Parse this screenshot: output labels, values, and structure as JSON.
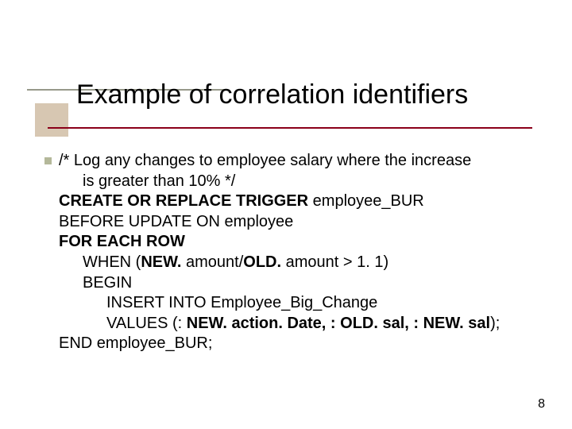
{
  "title": "Example of correlation identifiers",
  "page_number": "8",
  "body": {
    "comment_l1": "/* Log any changes to employee salary where the increase",
    "comment_l2": "is greater than 10% */",
    "create_b": "CREATE OR REPLACE TRIGGER ",
    "create_r": "employee_BUR",
    "before": "BEFORE UPDATE ON employee",
    "for_each": "FOR EACH ROW",
    "when_pre": "WHEN (",
    "when_new": "NEW.",
    "when_mid": " amount/",
    "when_old": "OLD.",
    "when_post": " amount > 1. 1)",
    "begin": "BEGIN",
    "insert": "INSERT INTO Employee_Big_Change",
    "values_pre": "VALUES (:",
    "values_new1": " NEW. action. Date, ",
    "values_old1": ": OLD. sal, ",
    "values_new2": ": NEW. sal",
    "values_post": ");",
    "end": "END employee_BUR;"
  }
}
